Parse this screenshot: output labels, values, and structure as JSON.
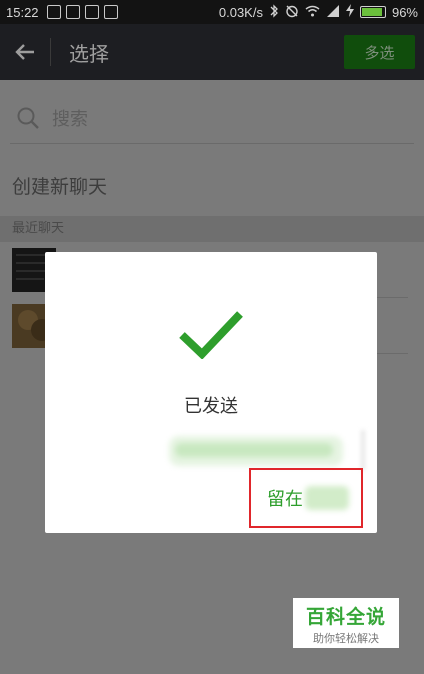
{
  "status_bar": {
    "time": "15:22",
    "network_speed": "0.03K/s",
    "battery": "96%",
    "icons": [
      "notification-icon",
      "mail-icon",
      "app-icon",
      "app-icon",
      "bluetooth-icon",
      "alarm-icon",
      "wifi-icon",
      "signal-icon",
      "charging-icon",
      "battery-icon"
    ]
  },
  "app_bar": {
    "title": "选择",
    "multi_select_label": "多选"
  },
  "search": {
    "placeholder": "搜索"
  },
  "new_chat_label": "创建新聊天",
  "recent_section": {
    "header": "最近聊天",
    "items": [
      {},
      {}
    ]
  },
  "dialog": {
    "status_text": "已发送",
    "stay_label": "留在",
    "accent_color": "#2e9e2c",
    "highlight_color": "#e0262b"
  },
  "watermark": {
    "title": "百科全说",
    "subtitle": "助你轻松解决"
  }
}
